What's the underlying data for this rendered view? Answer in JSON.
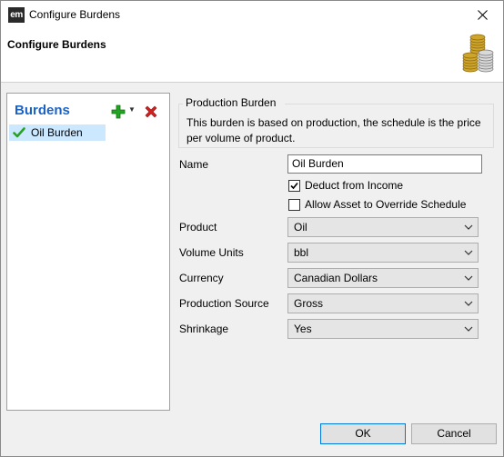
{
  "window": {
    "title": "Configure Burdens",
    "app_icon": "em"
  },
  "header": {
    "title": "Configure Burdens",
    "icon": "coins-icon"
  },
  "sidebar": {
    "title": "Burdens",
    "items": [
      {
        "label": "Oil Burden",
        "selected": true
      }
    ]
  },
  "group": {
    "legend": "Production Burden",
    "description": "This burden is based on production, the schedule is the price per volume of product."
  },
  "form": {
    "name_label": "Name",
    "name_value": "Oil Burden",
    "deduct_label": "Deduct from Income",
    "deduct_checked": true,
    "allow_label": "Allow Asset to Override Schedule",
    "allow_checked": false,
    "product_label": "Product",
    "product_value": "Oil",
    "volume_label": "Volume Units",
    "volume_value": "bbl",
    "currency_label": "Currency",
    "currency_value": "Canadian Dollars",
    "source_label": "Production Source",
    "source_value": "Gross",
    "shrinkage_label": "Shrinkage",
    "shrinkage_value": "Yes"
  },
  "buttons": {
    "ok": "OK",
    "cancel": "Cancel"
  },
  "colors": {
    "accent": "#1a63c6",
    "selection": "#cce8ff",
    "add": "#22a322",
    "delete": "#d42020"
  }
}
